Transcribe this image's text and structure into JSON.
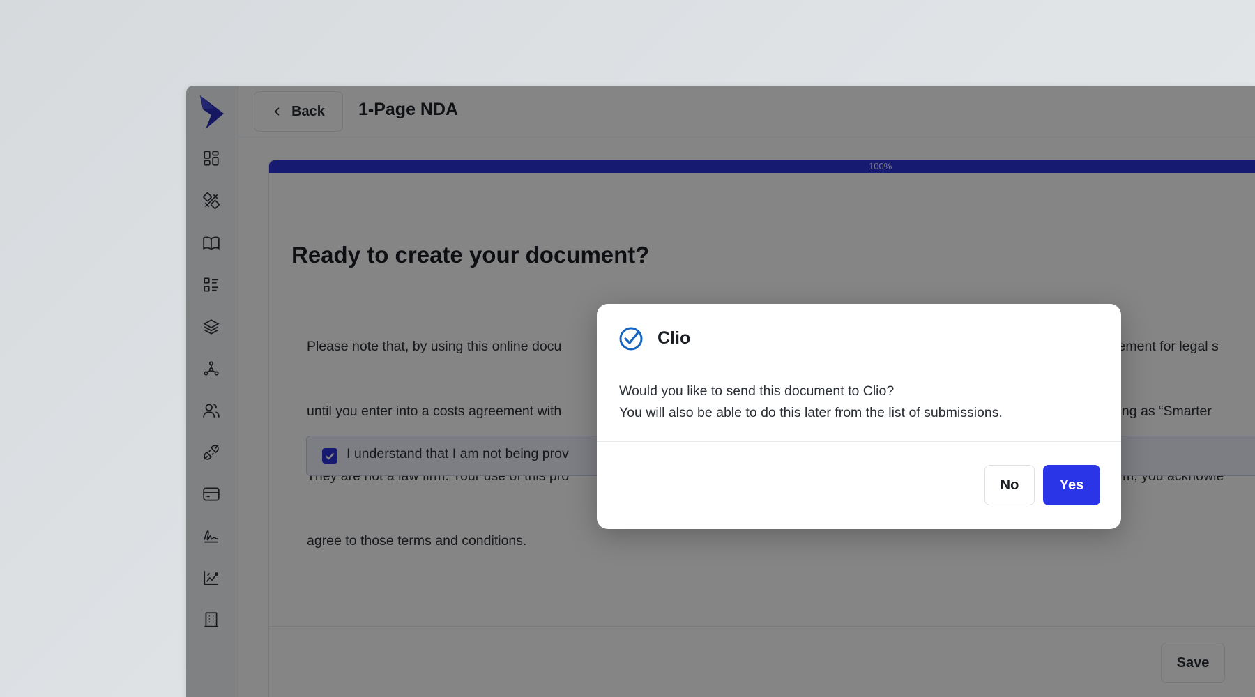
{
  "header": {
    "back_label": "Back",
    "document_title": "1-Page NDA"
  },
  "sidebar": {
    "items": [
      {
        "icon": "dashboard-icon"
      },
      {
        "icon": "design-tools-icon"
      },
      {
        "icon": "book-icon"
      },
      {
        "icon": "list-icon"
      },
      {
        "icon": "layers-icon"
      },
      {
        "icon": "workflow-icon"
      },
      {
        "icon": "users-icon"
      },
      {
        "icon": "integrations-icon"
      },
      {
        "icon": "card-icon"
      },
      {
        "icon": "signature-icon"
      },
      {
        "icon": "analytics-icon"
      },
      {
        "icon": "building-icon"
      }
    ]
  },
  "progress": {
    "value_percent": 100,
    "label": "100%"
  },
  "main": {
    "heading": "Ready to create your document?",
    "body_lines": [
      "Please note that, by using this online docu",
      "until you enter into a costs agreement with",
      "They are not a law firm. Your use of this pro",
      "agree to those terms and conditions."
    ],
    "body_lines_right": [
      "gagement for legal s",
      "trading as “Smarter",
      "e form, you acknowle"
    ],
    "acknowledgement_text": "I understand that I am not being prov",
    "acknowledgement_checked": true,
    "save_label": "Save"
  },
  "modal": {
    "title": "Clio",
    "line1": "Would you like to send this document to Clio?",
    "line2": "You will also be able to do this later from the list of submissions.",
    "no_label": "No",
    "yes_label": "Yes"
  },
  "colors": {
    "accent": "#2b35e8",
    "progress": "#2b35d8",
    "logo": "#2a2fb8"
  }
}
